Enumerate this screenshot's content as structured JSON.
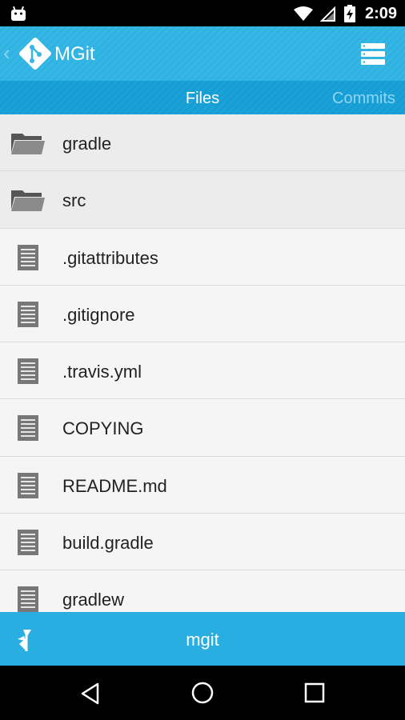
{
  "status_bar": {
    "time": "2:09",
    "icons": [
      "android-debug-icon",
      "wifi-icon",
      "signal-icon",
      "battery-charging-icon"
    ]
  },
  "action_bar": {
    "title": "MGit",
    "logo_icon": "git-logo-icon",
    "menu_icon": "repo-list-icon"
  },
  "tabs": {
    "files": "Files",
    "commits": "Commits"
  },
  "files": [
    {
      "name": "gradle",
      "type": "folder"
    },
    {
      "name": "src",
      "type": "folder"
    },
    {
      "name": ".gitattributes",
      "type": "file"
    },
    {
      "name": ".gitignore",
      "type": "file"
    },
    {
      "name": ".travis.yml",
      "type": "file"
    },
    {
      "name": "COPYING",
      "type": "file"
    },
    {
      "name": "README.md",
      "type": "file"
    },
    {
      "name": "build.gradle",
      "type": "file"
    },
    {
      "name": "gradlew",
      "type": "file"
    }
  ],
  "bottom_bar": {
    "branch": "mgit",
    "branch_icon": "branch-icon"
  },
  "colors": {
    "action_bar": "#35b8e6",
    "tab_bar": "#1aa3d9",
    "bottom_bar": "#29aee2",
    "list_background": "#f5f5f5"
  }
}
